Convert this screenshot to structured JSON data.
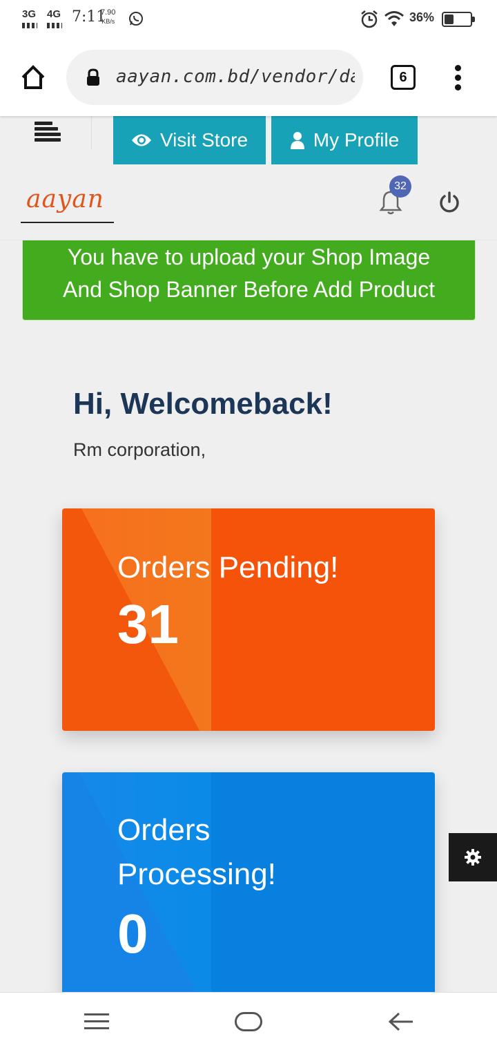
{
  "status_bar": {
    "net1": "3G",
    "net2": "4G",
    "time": "7:11",
    "speed_value": "7.90",
    "speed_unit": "KB/s",
    "battery": "36%",
    "battery_level": 0.36,
    "icons": [
      "whatsapp-icon",
      "alarm-icon",
      "wifi-icon",
      "battery-icon"
    ]
  },
  "browser": {
    "url": "aayan.com.bd/vendor/dash",
    "tab_count": "6",
    "icons": [
      "home-icon",
      "lock-icon",
      "more-vert-icon"
    ]
  },
  "nav": {
    "visit_store": "Visit Store",
    "my_profile": "My Profile",
    "icons": [
      "menu-icon",
      "eye-icon",
      "user-icon"
    ]
  },
  "header": {
    "logo": "aayan",
    "notification_count": "32",
    "icons": [
      "bell-icon",
      "power-icon"
    ]
  },
  "alert": {
    "line1": "You have to upload your Shop Image",
    "line2": "And Shop Banner Before Add Product"
  },
  "welcome": {
    "title": "Hi, Welcomeback!",
    "company": "Rm corporation,"
  },
  "cards": [
    {
      "line1": "Orders Pending!",
      "line2": "",
      "value": "31",
      "color": "#f5520a"
    },
    {
      "line1": "Orders",
      "line2": "Processing!",
      "value": "0",
      "color": "#0780e0"
    }
  ],
  "colors": {
    "nav_button": "#17a2b8",
    "alert_green": "#43ac1e",
    "welcome_navy": "#1c3658",
    "logo_orange": "#e2541a",
    "badge": "#4f67b5"
  }
}
